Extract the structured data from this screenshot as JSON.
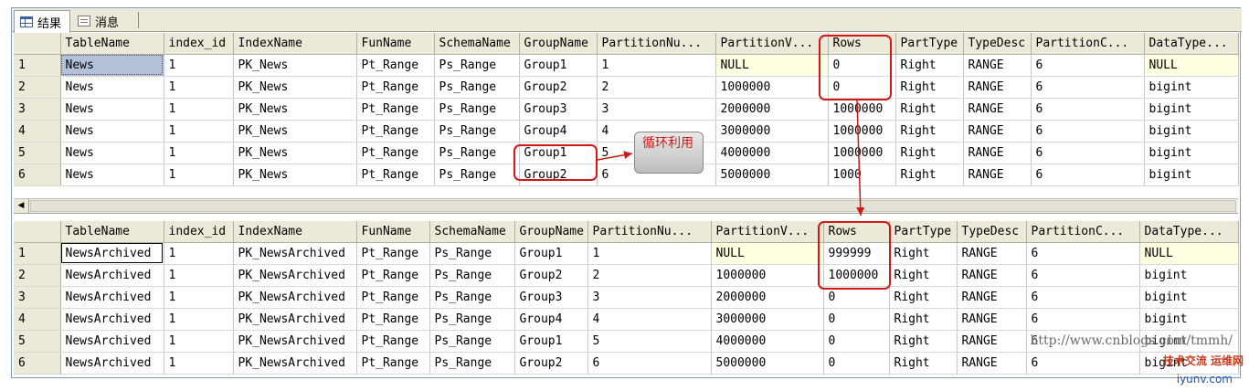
{
  "tabs": [
    {
      "label": "结果",
      "icon": "results-grid-icon"
    },
    {
      "label": "消息",
      "icon": "messages-icon"
    }
  ],
  "columns": [
    "TableName",
    "index_id",
    "IndexName",
    "FunName",
    "SchemaName",
    "GroupName",
    "PartitionNu...",
    "PartitionV...",
    "Rows",
    "PartType",
    "TypeDesc",
    "PartitionC...",
    "DataType..."
  ],
  "grid1": {
    "rows": [
      {
        "rn": "1",
        "cells": [
          "News",
          "1",
          "PK_News",
          "Pt_Range",
          "Ps_Range",
          "Group1",
          "1",
          "NULL",
          "0",
          "Right",
          "RANGE",
          "6",
          "NULL"
        ]
      },
      {
        "rn": "2",
        "cells": [
          "News",
          "1",
          "PK_News",
          "Pt_Range",
          "Ps_Range",
          "Group2",
          "2",
          "1000000",
          "0",
          "Right",
          "RANGE",
          "6",
          "bigint"
        ]
      },
      {
        "rn": "3",
        "cells": [
          "News",
          "1",
          "PK_News",
          "Pt_Range",
          "Ps_Range",
          "Group3",
          "3",
          "2000000",
          "1000000",
          "Right",
          "RANGE",
          "6",
          "bigint"
        ]
      },
      {
        "rn": "4",
        "cells": [
          "News",
          "1",
          "PK_News",
          "Pt_Range",
          "Ps_Range",
          "Group4",
          "4",
          "3000000",
          "1000000",
          "Right",
          "RANGE",
          "6",
          "bigint"
        ]
      },
      {
        "rn": "5",
        "cells": [
          "News",
          "1",
          "PK_News",
          "Pt_Range",
          "Ps_Range",
          "Group1",
          "5",
          "4000000",
          "1000000",
          "Right",
          "RANGE",
          "6",
          "bigint"
        ]
      },
      {
        "rn": "6",
        "cells": [
          "News",
          "1",
          "PK_News",
          "Pt_Range",
          "Ps_Range",
          "Group2",
          "6",
          "5000000",
          "1000",
          "Right",
          "RANGE",
          "6",
          "bigint"
        ]
      }
    ]
  },
  "grid2": {
    "rows": [
      {
        "rn": "1",
        "cells": [
          "NewsArchived",
          "1",
          "PK_NewsArchived",
          "Pt_Range",
          "Ps_Range",
          "Group1",
          "1",
          "NULL",
          "999999",
          "Right",
          "RANGE",
          "6",
          "NULL"
        ]
      },
      {
        "rn": "2",
        "cells": [
          "NewsArchived",
          "1",
          "PK_NewsArchived",
          "Pt_Range",
          "Ps_Range",
          "Group2",
          "2",
          "1000000",
          "1000000",
          "Right",
          "RANGE",
          "6",
          "bigint"
        ]
      },
      {
        "rn": "3",
        "cells": [
          "NewsArchived",
          "1",
          "PK_NewsArchived",
          "Pt_Range",
          "Ps_Range",
          "Group3",
          "3",
          "2000000",
          "0",
          "Right",
          "RANGE",
          "6",
          "bigint"
        ]
      },
      {
        "rn": "4",
        "cells": [
          "NewsArchived",
          "1",
          "PK_NewsArchived",
          "Pt_Range",
          "Ps_Range",
          "Group4",
          "4",
          "3000000",
          "0",
          "Right",
          "RANGE",
          "6",
          "bigint"
        ]
      },
      {
        "rn": "5",
        "cells": [
          "NewsArchived",
          "1",
          "PK_NewsArchived",
          "Pt_Range",
          "Ps_Range",
          "Group1",
          "5",
          "4000000",
          "0",
          "Right",
          "RANGE",
          "6",
          "bigint"
        ]
      },
      {
        "rn": "6",
        "cells": [
          "NewsArchived",
          "1",
          "PK_NewsArchived",
          "Pt_Range",
          "Ps_Range",
          "Group2",
          "6",
          "5000000",
          "0",
          "Right",
          "RANGE",
          "6",
          "bigint"
        ]
      }
    ]
  },
  "annotation": {
    "text": "循环利用"
  },
  "watermark": {
    "line1": "http://www.cnblogs.com/tmmh/",
    "line2": "技术交流 运维网",
    "line3": "iyunv.com"
  },
  "colors": {
    "highlight": "#d01818",
    "null_cell": "#ffffe1",
    "selected_cell": "#b4c0d8",
    "header": "#ece9d8"
  }
}
